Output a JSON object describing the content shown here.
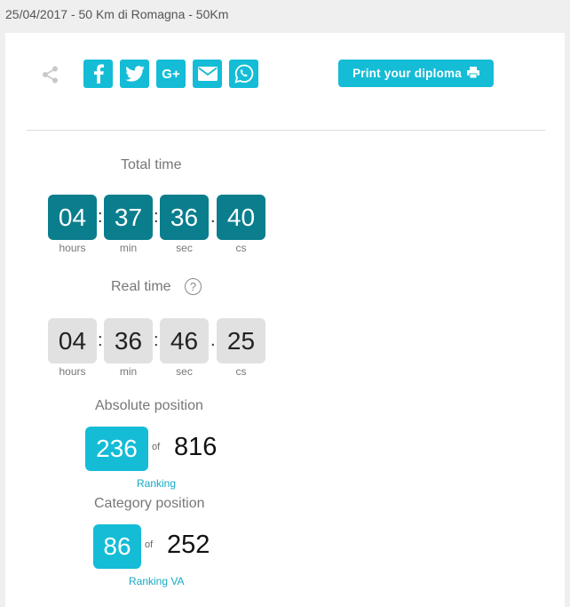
{
  "header": {
    "title": "25/04/2017 - 50 Km di Romagna - 50Km"
  },
  "share": {
    "buttons": [
      "facebook-icon",
      "twitter-icon",
      "google-plus-icon",
      "email-icon",
      "whatsapp-icon"
    ],
    "google_plus_text": "G+",
    "print_label": "Print your diploma"
  },
  "total_time": {
    "label": "Total time",
    "hours": "04",
    "min": "37",
    "sec": "36",
    "cs": "40"
  },
  "real_time": {
    "label": "Real time",
    "help": "?",
    "hours": "04",
    "min": "36",
    "sec": "46",
    "cs": "25"
  },
  "units": {
    "hours": "hours",
    "min": "min",
    "sec": "sec",
    "cs": "cs"
  },
  "separators": {
    "colon": ":",
    "dot": "."
  },
  "absolute_position": {
    "label": "Absolute position",
    "value": "236",
    "of": "of",
    "total": "816",
    "ranking_label": "Ranking"
  },
  "category_position": {
    "label": "Category position",
    "value": "86",
    "of": "of",
    "total": "252",
    "ranking_label": "Ranking VA"
  },
  "colors": {
    "accent": "#14bcd6",
    "time_dark": "#0a7e8d",
    "time_light": "#e1e1e1"
  }
}
